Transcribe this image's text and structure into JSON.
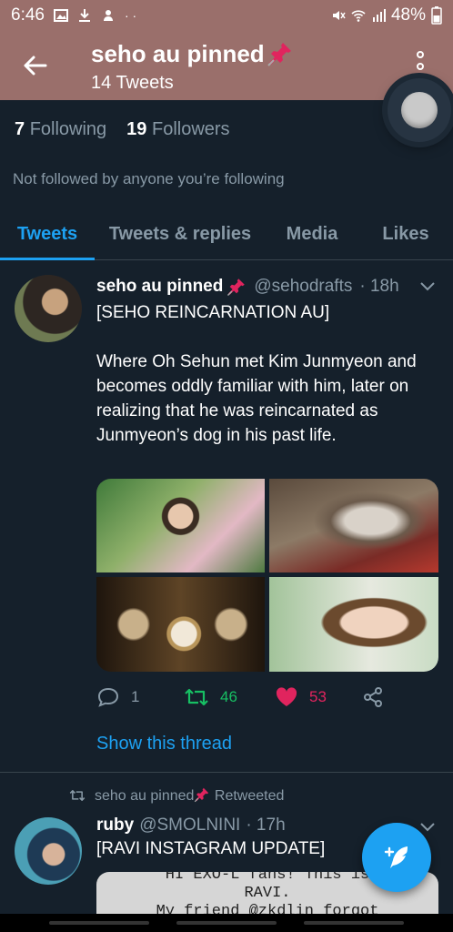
{
  "status_bar": {
    "time": "6:46",
    "battery": "48%"
  },
  "header": {
    "title": "seho au pinned",
    "subtitle": "14 Tweets"
  },
  "profile": {
    "following_count": "7",
    "following_label": "Following",
    "followers_count": "19",
    "followers_label": "Followers",
    "not_followed_text": "Not followed by anyone you’re following"
  },
  "tabs": [
    {
      "label": "Tweets",
      "active": true
    },
    {
      "label": "Tweets & replies",
      "active": false
    },
    {
      "label": "Media",
      "active": false
    },
    {
      "label": "Likes",
      "active": false
    }
  ],
  "tweet1": {
    "name": "seho au pinned",
    "handle": "@sehodrafts",
    "time": "· 18h",
    "text": "[SEHO REINCARNATION AU]\n\nWhere Oh Sehun met Kim Junmyeon and becomes oddly familiar with him, later on realizing that he was reincarnated as Junmyeon’s dog in his past life.",
    "replies": "1",
    "retweets": "46",
    "likes": "53",
    "show_thread": "Show this thread"
  },
  "tweet2": {
    "retweeted_by": "seho au pinned",
    "retweeted_label": "Retweeted",
    "name": "ruby",
    "handle": "@SMOLNINI",
    "time": "· 17h",
    "text": "[RAVI INSTAGRAM UPDATE]",
    "card_lines": [
      "HI EXO-L fans! This is",
      "RAVI.",
      "My friend @zkdlin forgot"
    ]
  },
  "colors": {
    "background": "#15202b",
    "header": "#9a6f6b",
    "accent": "#1da1f2",
    "retweet": "#17bf63",
    "like": "#e0245e",
    "muted": "#8899a6"
  }
}
